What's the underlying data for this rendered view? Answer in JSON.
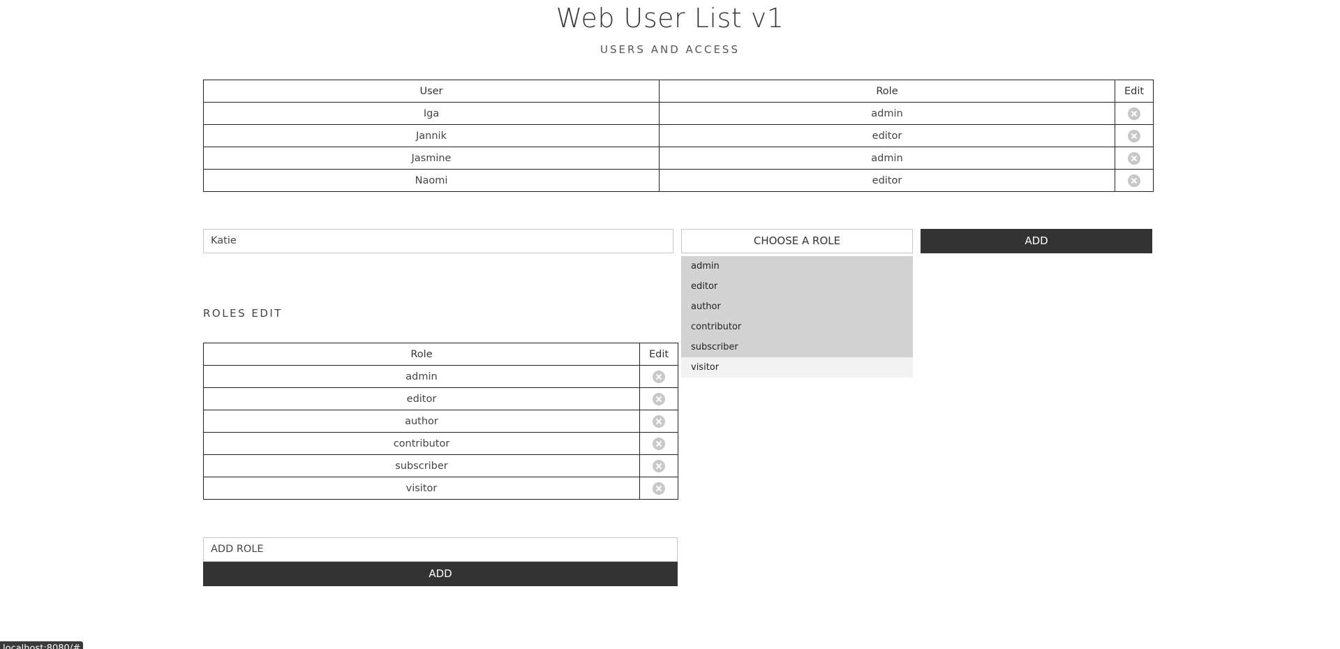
{
  "header": {
    "title": "Web User List v1",
    "subtitle": "USERS AND ACCESS"
  },
  "users_table": {
    "columns": [
      "User",
      "Role",
      "Edit"
    ],
    "rows": [
      {
        "user": "Iga",
        "role": "admin"
      },
      {
        "user": "Jannik",
        "role": "editor"
      },
      {
        "user": "Jasmine",
        "role": "admin"
      },
      {
        "user": "Naomi",
        "role": "editor"
      }
    ],
    "row_icon": "close-circle-icon"
  },
  "add_user_form": {
    "name_value": "Katie",
    "role_select_label": "CHOOSE A ROLE",
    "role_options": [
      "admin",
      "editor",
      "author",
      "contributor",
      "subscriber",
      "visitor"
    ],
    "add_label": "ADD"
  },
  "roles_section": {
    "heading": "ROLES EDIT",
    "columns": [
      "Role",
      "Edit"
    ],
    "rows": [
      "admin",
      "editor",
      "author",
      "contributor",
      "subscriber",
      "visitor"
    ],
    "row_icon": "close-circle-icon"
  },
  "add_role_form": {
    "placeholder": "ADD ROLE",
    "add_label": "ADD"
  },
  "status_bar": {
    "url": "localhost:8080/#"
  },
  "colors": {
    "button_bg": "#333333",
    "dropdown_option_bg": "#d3d3d3",
    "dropdown_hover_bg": "#f2f2f2",
    "delete_icon": "#c8c8c8"
  }
}
